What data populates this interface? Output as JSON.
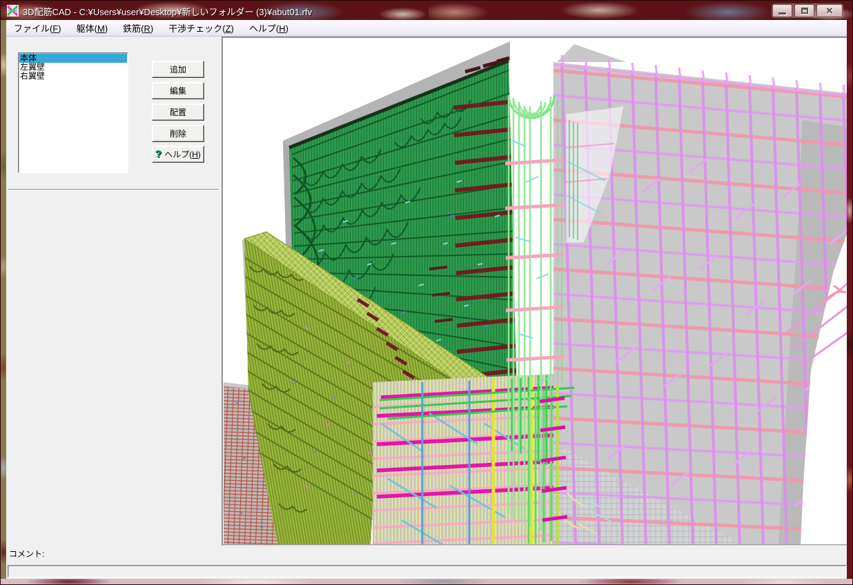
{
  "window": {
    "title": "3D配筋CAD - C:¥Users¥user¥Desktop¥新しいフォルダー (3)¥abut01.rfv",
    "icons": {
      "app": "app-logo-x-icon",
      "minimize": "minimize-icon",
      "restore": "restore-icon",
      "close": "close-icon"
    },
    "close_glyph": "✕"
  },
  "menu_bar": {
    "items": [
      {
        "pre": "ファイル(",
        "key": "F",
        "post": ")"
      },
      {
        "pre": "躯体(",
        "key": "M",
        "post": ")"
      },
      {
        "pre": "鉄筋(",
        "key": "R",
        "post": ")"
      },
      {
        "pre": "干渉チェック(",
        "key": "Z",
        "post": ")"
      },
      {
        "pre": "ヘルプ(",
        "key": "H",
        "post": ")"
      }
    ]
  },
  "sidebar": {
    "list": {
      "items": [
        {
          "label": "本体",
          "selected": true
        },
        {
          "label": "左翼壁",
          "selected": false
        },
        {
          "label": "右翼壁",
          "selected": false
        }
      ],
      "selection_color": "#35a8d8"
    },
    "buttons": {
      "add": "追加",
      "edit": "編集",
      "place": "配置",
      "delete": "削除",
      "help_icon_glyph": "?",
      "help_pre": "ヘルプ(",
      "help_key": "H",
      "help_post": ")"
    }
  },
  "viewport": {
    "description": "3D rebar model of bridge abutment (body, left wing wall, right wing wall)",
    "colors": {
      "concrete_gray": "#c6c6c6",
      "wall_rebar_green": "#2f9d4f",
      "wing_rebar_olive": "#9cb83d",
      "body_rebar_pink": "#ef96a8",
      "body_rebar_violet": "#dc9ae6",
      "cage_yellow": "#ecec8e",
      "cage_magenta": "#e217a5",
      "tie_cyan": "#6cc4e4",
      "footing_mesh_red": "#c05a4a",
      "stub_maroon": "#6e1f1f",
      "edge_hoop_lightgreen": "#92e896"
    }
  },
  "status_bar": {
    "comment_label": "コメント:",
    "comment_value": ""
  }
}
